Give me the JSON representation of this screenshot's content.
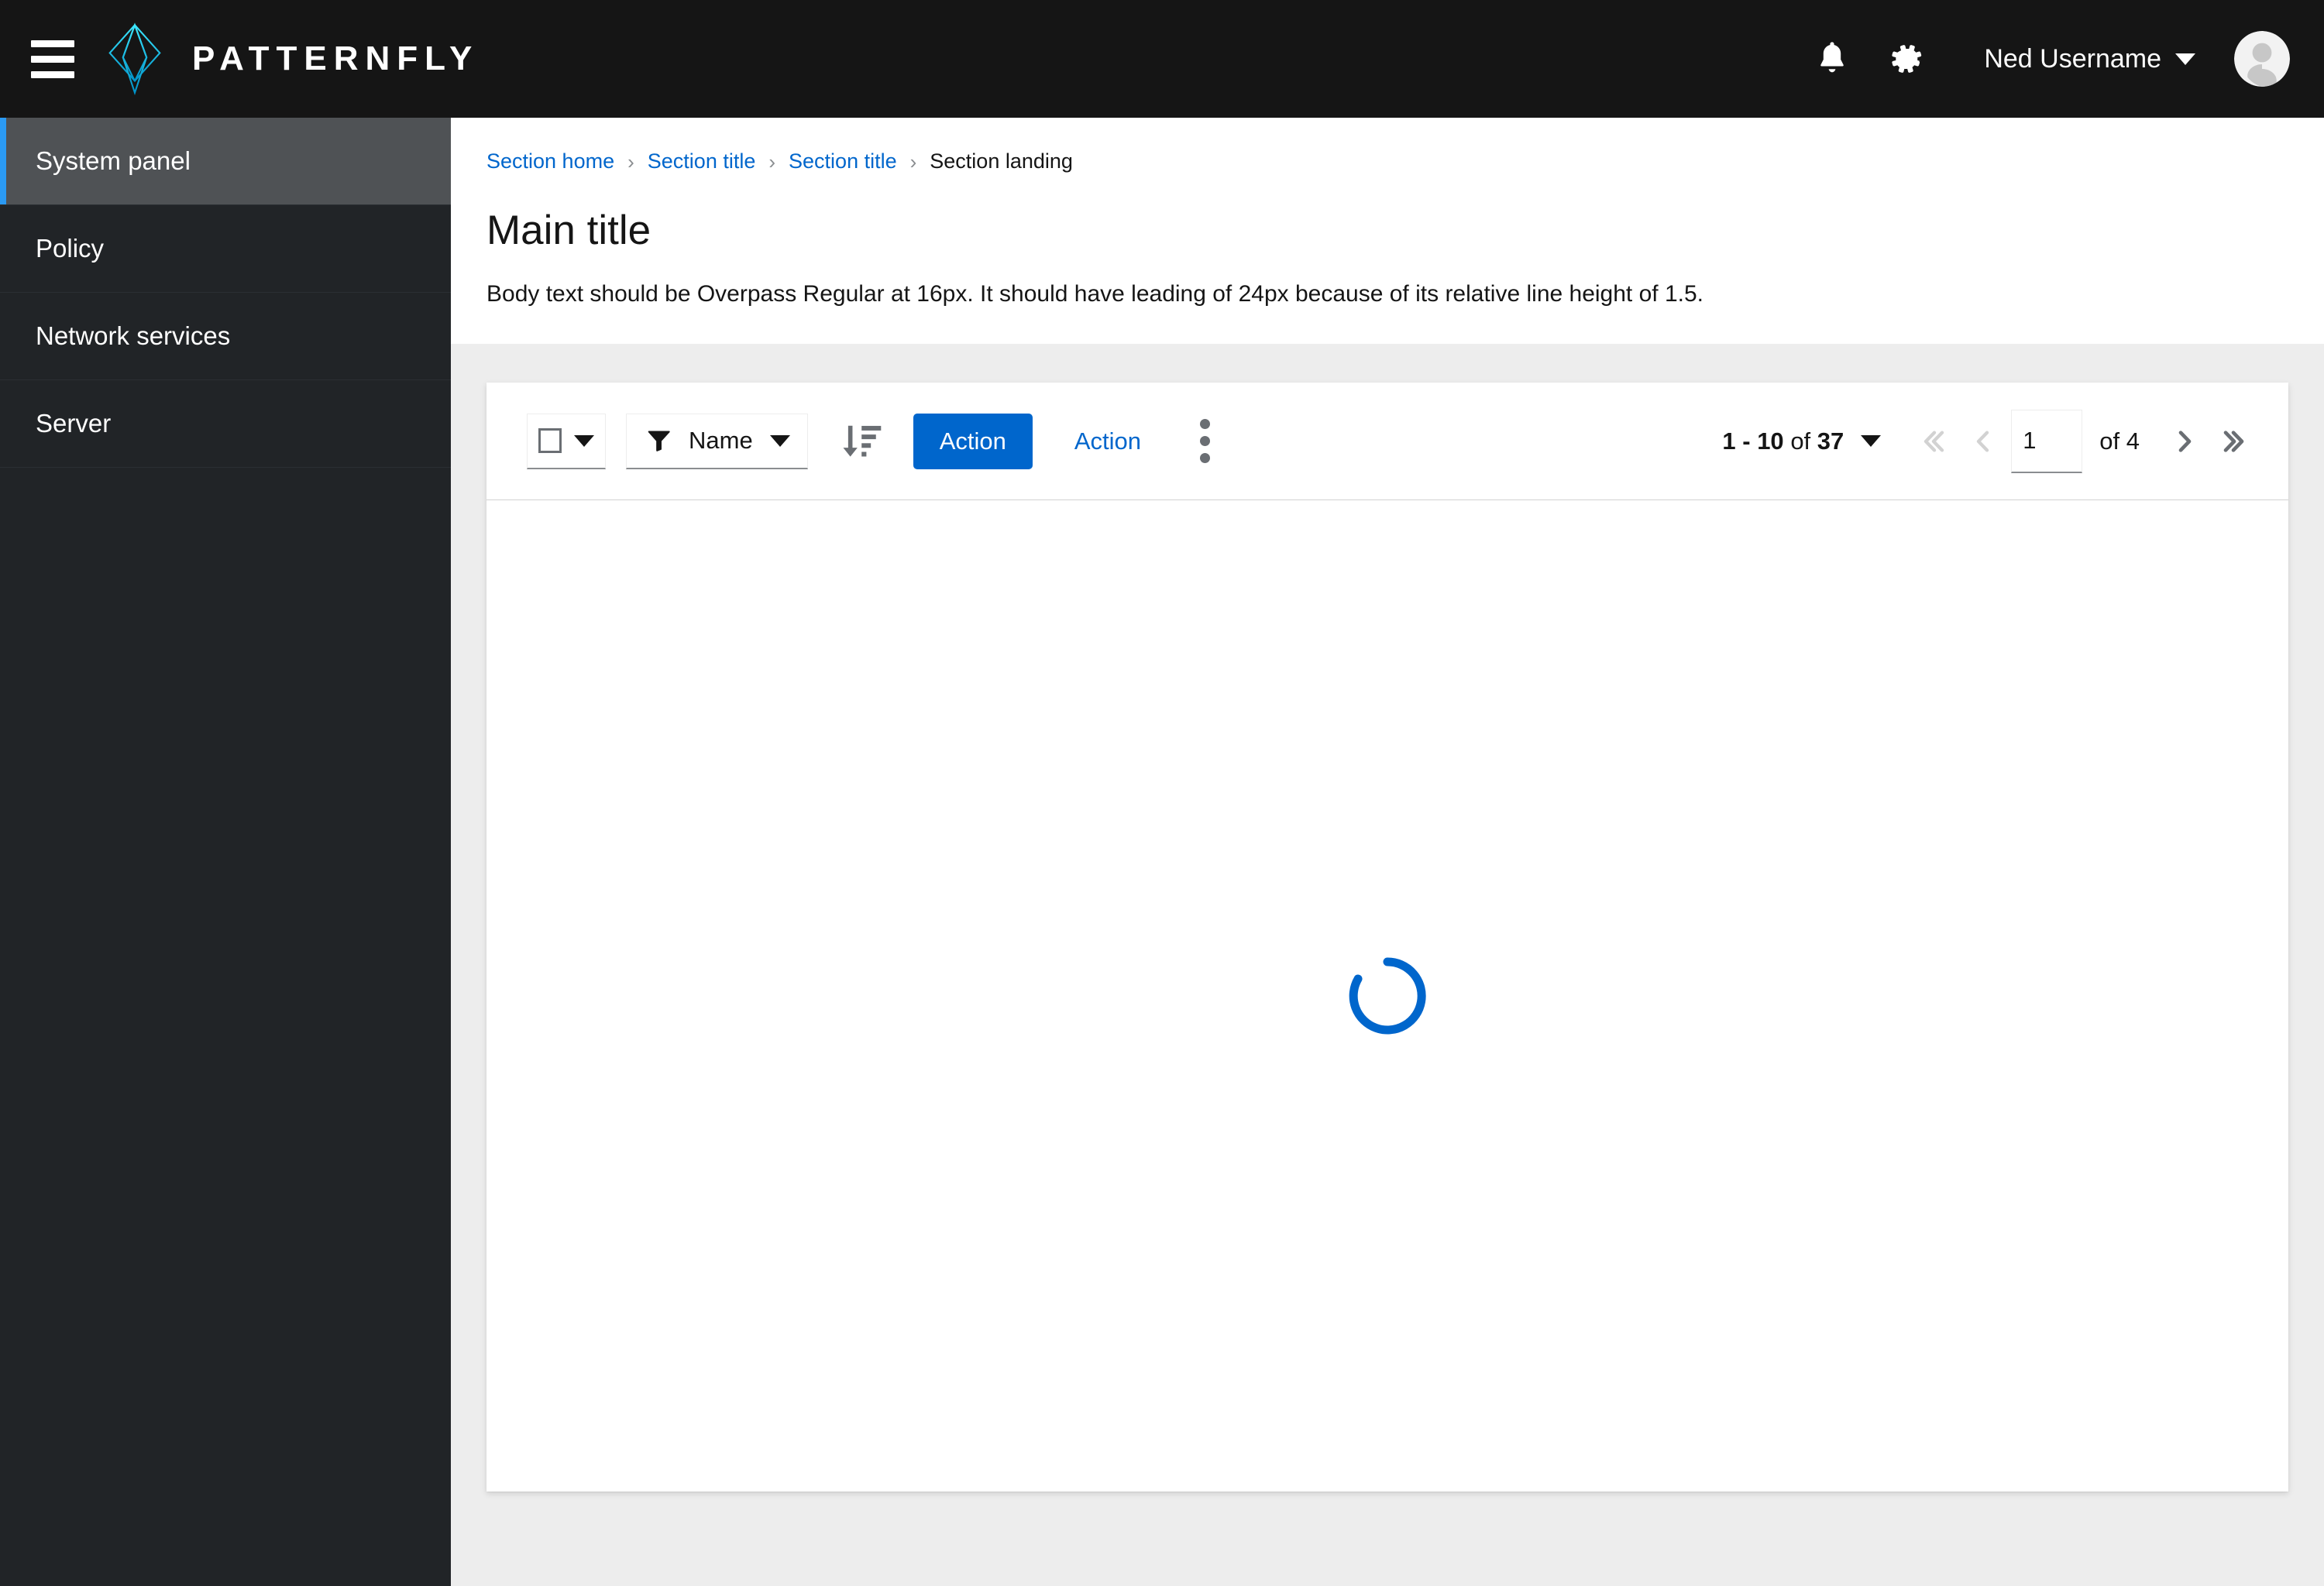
{
  "masthead": {
    "hamburger_label": "Global navigation",
    "brand_name": "PATTERNFLY",
    "notifications_label": "Notifications",
    "settings_label": "Settings",
    "username": "Ned Username",
    "avatar_label": "User avatar"
  },
  "sidebar": {
    "items": [
      {
        "label": "System panel",
        "active": true
      },
      {
        "label": "Policy",
        "active": false
      },
      {
        "label": "Network services",
        "active": false
      },
      {
        "label": "Server",
        "active": false
      }
    ]
  },
  "breadcrumb": {
    "separator": "›",
    "items": [
      {
        "label": "Section home",
        "current": false
      },
      {
        "label": "Section title",
        "current": false
      },
      {
        "label": "Section title",
        "current": false
      },
      {
        "label": "Section landing",
        "current": true
      }
    ]
  },
  "content": {
    "title": "Main title",
    "body_text": "Body text should be Overpass Regular at 16px. It should have leading of 24px because of its relative line height of 1.5."
  },
  "toolbar": {
    "bulk_select_label": "Select all",
    "filter_label": "Name",
    "sort_label": "Sort",
    "primary_action_label": "Action",
    "secondary_action_label": "Action",
    "kebab_label": "More actions"
  },
  "pagination": {
    "range": "1 - 10",
    "of_word": "of",
    "total": "37",
    "first_label": "Go to first page",
    "previous_label": "Go to previous page",
    "page_value": "1",
    "page_of": "of 4",
    "next_label": "Go to next page",
    "last_label": "Go to last page"
  },
  "card": {
    "loading_label": "Loading"
  },
  "colors": {
    "masthead_bg": "#151515",
    "sidebar_bg": "#212427",
    "sidebar_active_bg": "#4F5255",
    "sidebar_active_accent": "#2B9AF3",
    "link_blue": "#0066CC",
    "primary_button_bg": "#0066CC",
    "page_bg": "#EDEDED",
    "spinner_color": "#0066CC",
    "icon_gray": "#6A6E73",
    "disabled_gray": "#D2D2D2"
  }
}
